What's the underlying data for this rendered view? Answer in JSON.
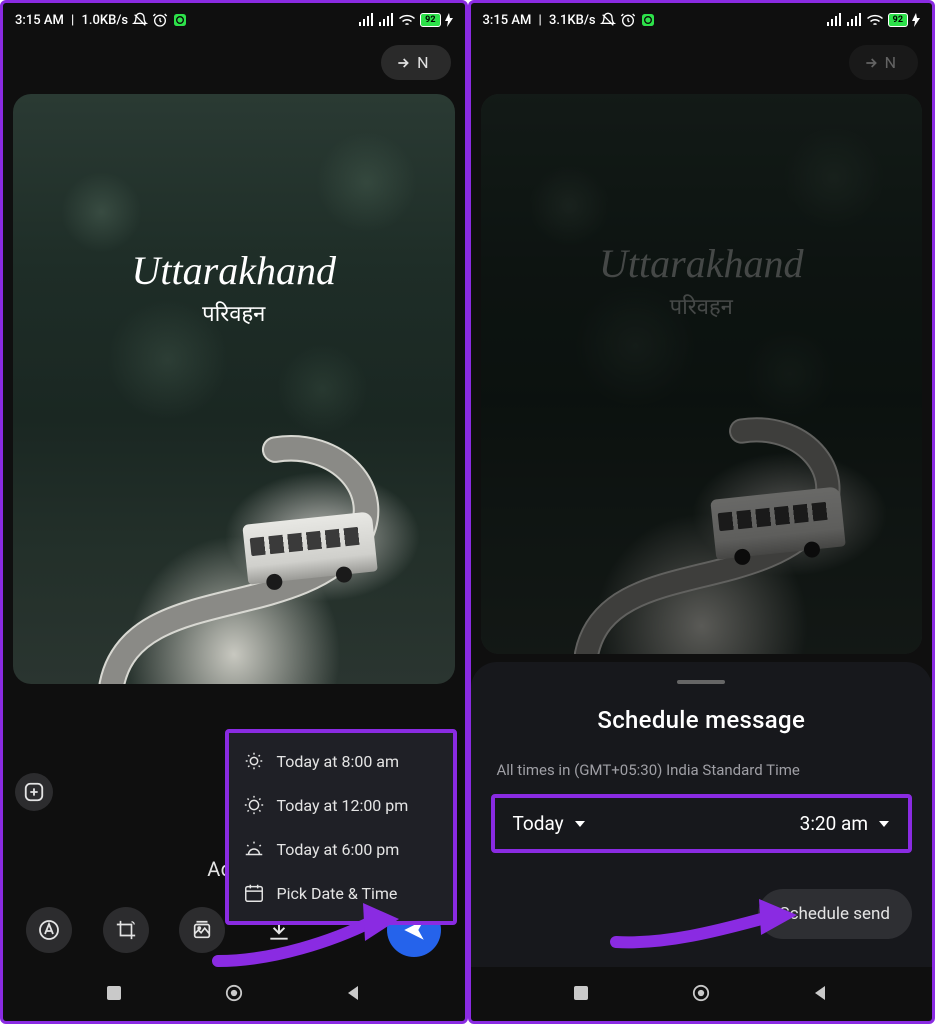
{
  "left": {
    "status": {
      "time": "3:15 AM",
      "speed": "1.0KB/s",
      "battery": "92"
    },
    "forward": "N",
    "photo": {
      "title": "Uttarakhand",
      "subtitle": "परिवहन"
    },
    "menu": [
      {
        "label": "Today at 8:00 am"
      },
      {
        "label": "Today at 12:00 pm"
      },
      {
        "label": "Today at 6:00 pm"
      },
      {
        "label": "Pick Date & Time"
      }
    ],
    "caption": "Add a"
  },
  "right": {
    "status": {
      "time": "3:15 AM",
      "speed": "3.1KB/s",
      "battery": "92"
    },
    "forward": "N",
    "photo": {
      "title": "Uttarakhand",
      "subtitle": "परिवहन"
    },
    "sheet": {
      "title": "Schedule message",
      "tz": "All times in (GMT+05:30) India Standard Time",
      "date": "Today",
      "time": "3:20 am",
      "cta": "Schedule send"
    }
  }
}
